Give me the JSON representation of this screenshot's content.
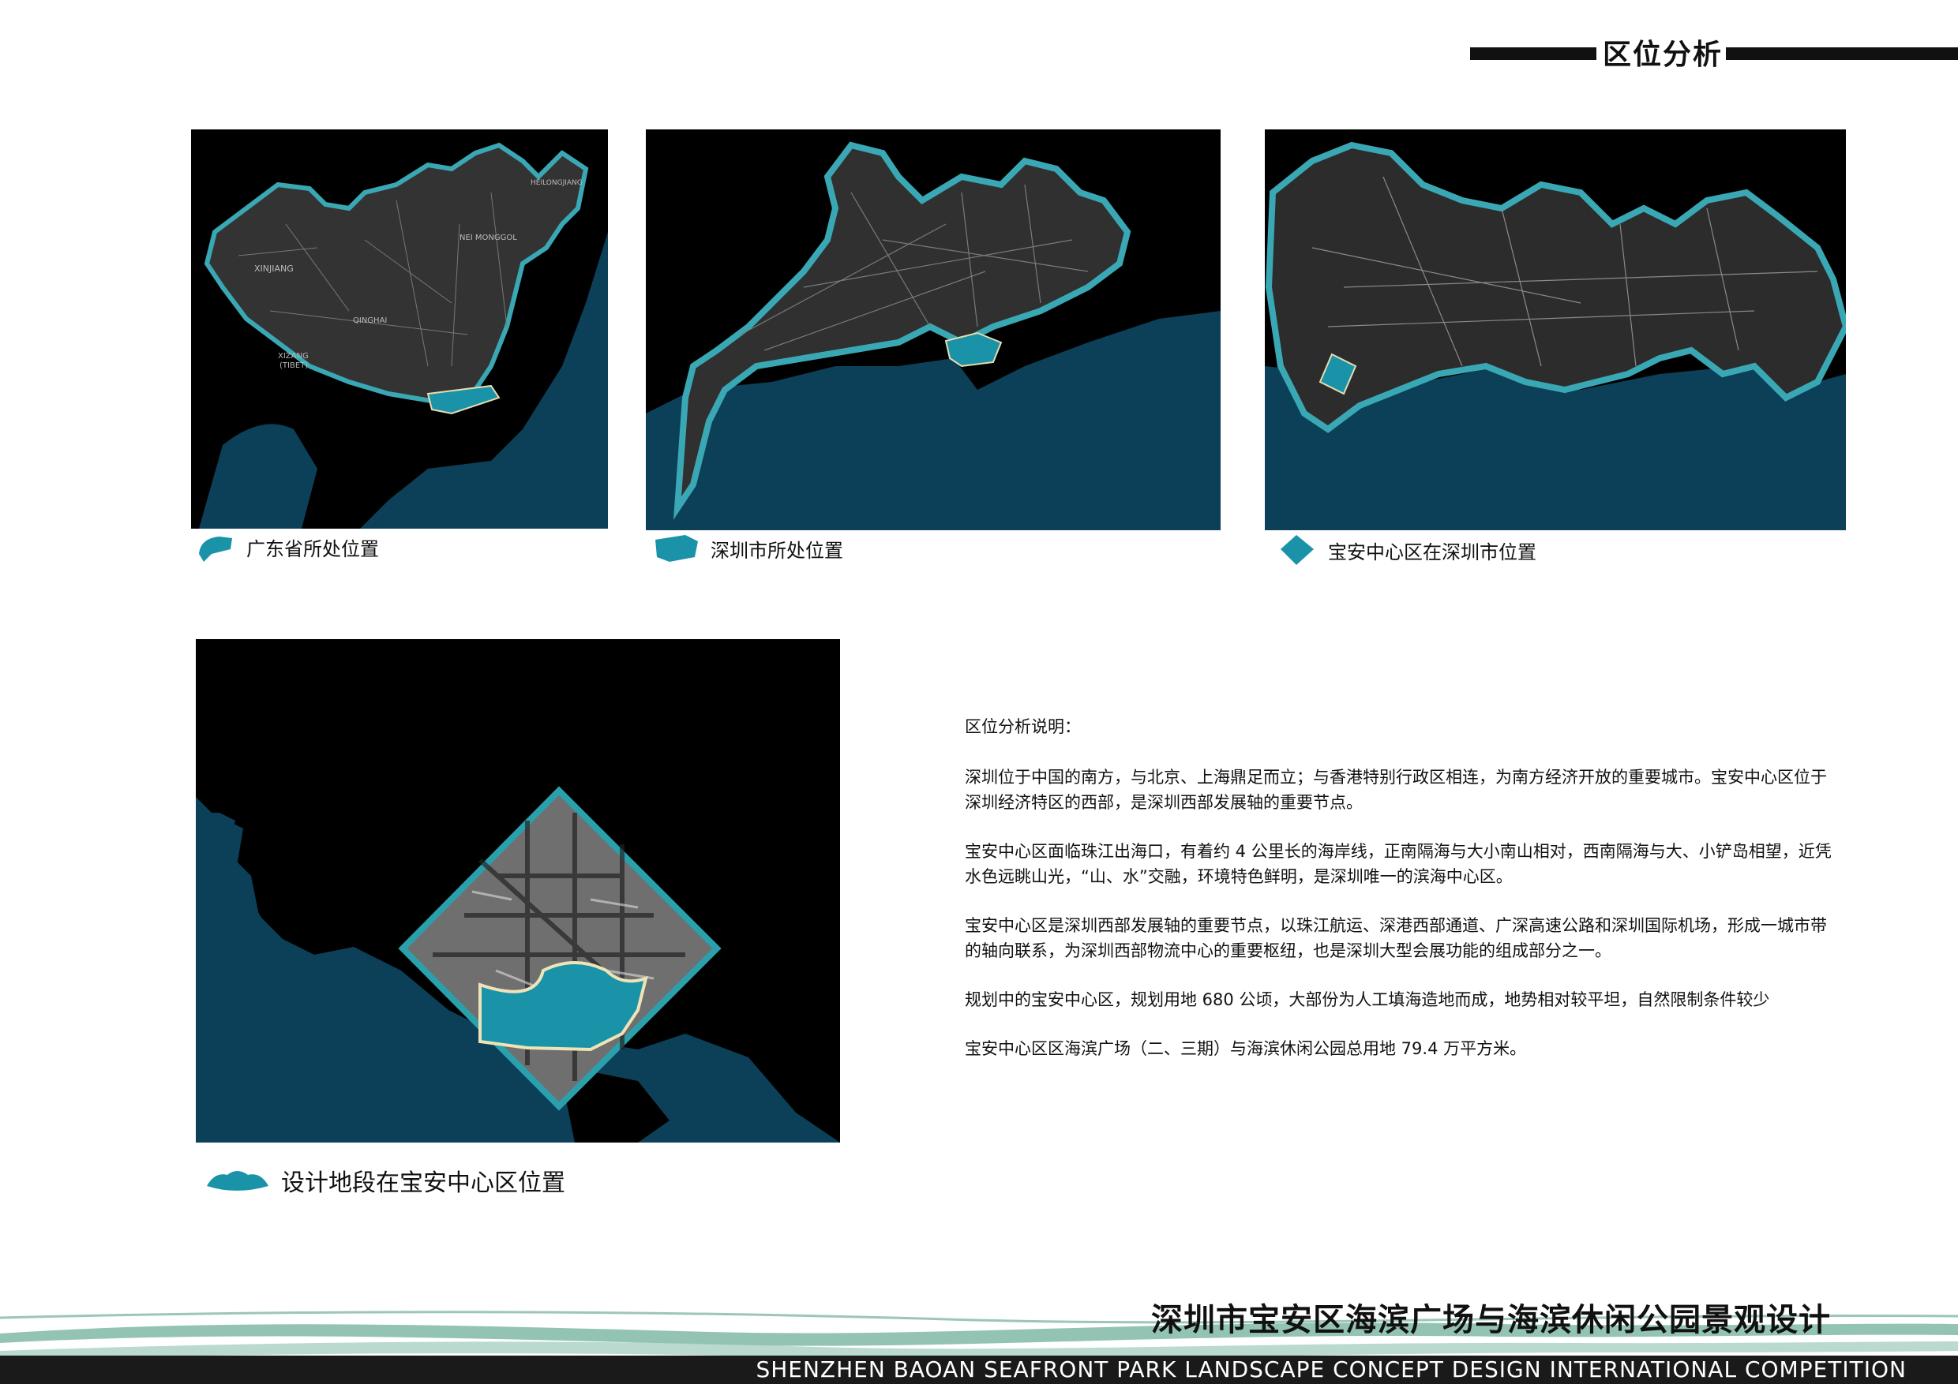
{
  "header": {
    "title": "区位分析"
  },
  "maps": {
    "guangdong": {
      "caption": "广东省所处位置"
    },
    "shenzhen": {
      "caption": "深圳市所处位置"
    },
    "baoan_center": {
      "caption": "宝安中心区在深圳市位置"
    },
    "design_site": {
      "caption": "设计地段在宝安中心区位置"
    },
    "labels": {
      "xinjiang": "XINJIANG",
      "qinghai": "QINGHAI",
      "xizang": "XIZANG",
      "tibet": "(TIBET)",
      "nei_monggol": "NEI MONGGOL",
      "heilongjiang": "HEILONGJIANG"
    }
  },
  "notes": {
    "heading": "区位分析说明：",
    "paragraphs": [
      "深圳位于中国的南方，与北京、上海鼎足而立；与香港特别行政区相连，为南方经济开放的重要城市。宝安中心区位于深圳经济特区的西部，是深圳西部发展轴的重要节点。",
      "宝安中心区面临珠江出海口，有着约 4 公里长的海岸线，正南隔海与大小南山相对，西南隔海与大、小铲岛相望，近凭水色远眺山光，“山、水”交融，环境特色鲜明，是深圳唯一的滨海中心区。",
      "宝安中心区是深圳西部发展轴的重要节点，以珠江航运、深港西部通道、广深高速公路和深圳国际机场，形成一城市带的轴向联系，为深圳西部物流中心的重要枢纽，也是深圳大型会展功能的组成部分之一。",
      "规划中的宝安中心区，规划用地 680 公顷，大部份为人工填海造地而成，地势相对较平坦，自然限制条件较少",
      "宝安中心区区海滨广场（二、三期）与海滨休闲公园总用地 79.4 万平方米。"
    ]
  },
  "footer": {
    "title_cn": "深圳市宝安区海滨广场与海滨休闲公园景观设计",
    "title_en": "SHENZHEN BAOAN  SEAFRONT PARK LANDSCAPE CONCEPT DESIGN INTERNATIONAL COMPETITION"
  },
  "colors": {
    "sea": "#0c4058",
    "highlight": "#1a93a8",
    "outline": "#3aa8b4",
    "land": "#2a2a2a",
    "panel_bg": "#000000"
  }
}
